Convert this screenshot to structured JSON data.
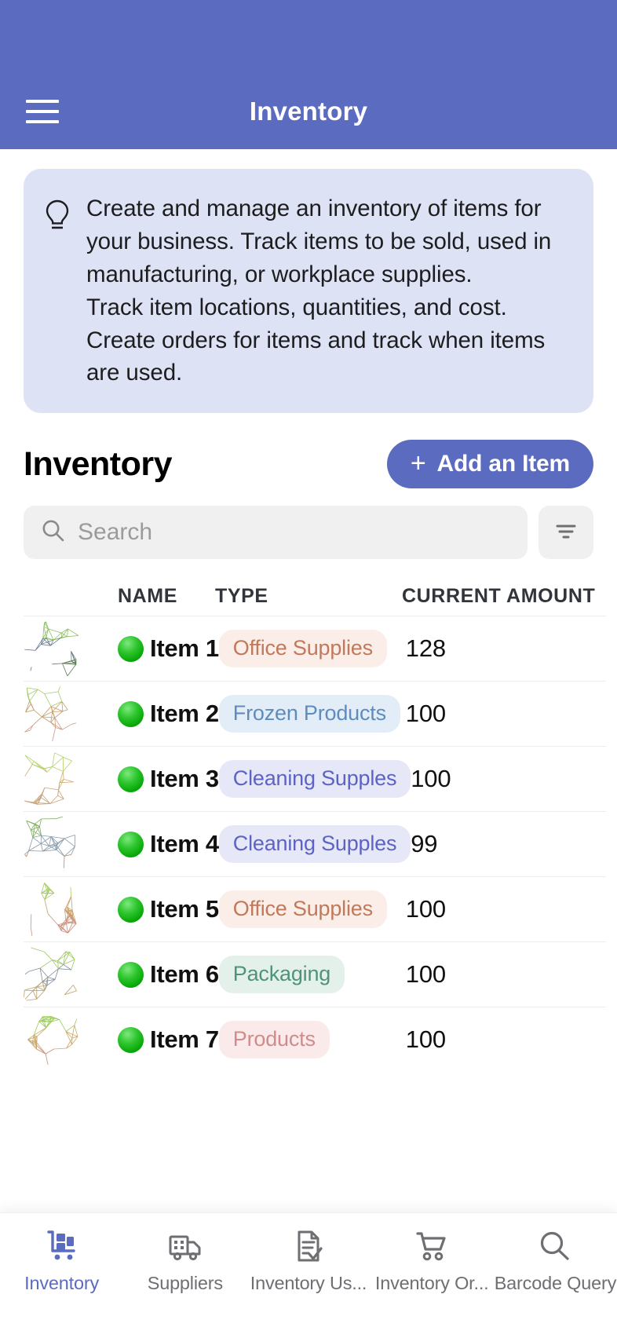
{
  "appbar": {
    "title": "Inventory",
    "menu_icon": "hamburger-menu-icon",
    "bg_color": "#5B6CC0"
  },
  "banner": {
    "icon": "lightbulb-icon",
    "lines": [
      "Create and manage an inventory of items for your business. Track items to be sold, used in manufacturing, or workplace supplies.",
      "Track item locations, quantities, and cost.",
      "Create orders for items and track when items are used."
    ],
    "bg_color": "#DEE2F5"
  },
  "section": {
    "title": "Inventory",
    "add_button_label": "Add an Item",
    "add_button_plus": "+",
    "add_button_color": "#5B6CC0"
  },
  "search": {
    "placeholder": "Search",
    "value": "",
    "icon": "search-icon",
    "filter_icon": "filter-sort-icon"
  },
  "table": {
    "columns": [
      "NAME",
      "TYPE",
      "CURRENT AMOUNT"
    ],
    "rows": [
      {
        "name": "Item 1",
        "type": "Office Supplies",
        "amount": "128",
        "status": "in-stock"
      },
      {
        "name": "Item 2",
        "type": "Frozen Products",
        "amount": "100",
        "status": "in-stock"
      },
      {
        "name": "Item 3",
        "type": "Cleaning Supples",
        "amount": "100",
        "status": "in-stock"
      },
      {
        "name": "Item 4",
        "type": "Cleaning Supples",
        "amount": "99",
        "status": "in-stock"
      },
      {
        "name": "Item 5",
        "type": "Office Supplies",
        "amount": "100",
        "status": "in-stock"
      },
      {
        "name": "Item 6",
        "type": "Packaging",
        "amount": "100",
        "status": "in-stock"
      },
      {
        "name": "Item 7",
        "type": "Products",
        "amount": "100",
        "status": "in-stock"
      }
    ],
    "chip_styles": {
      "Office Supplies": {
        "bg": "#FBEDE7",
        "fg": "#C07A5B"
      },
      "Frozen Products": {
        "bg": "#E3EDF8",
        "fg": "#5E8CBE"
      },
      "Cleaning Supples": {
        "bg": "#E6E7F7",
        "fg": "#5C63C4"
      },
      "Packaging": {
        "bg": "#E3F1EA",
        "fg": "#4F9478"
      },
      "Products": {
        "bg": "#FBEAEA",
        "fg": "#D08C8C"
      }
    },
    "status_color": "#16B516"
  },
  "bottom_nav": {
    "active_color": "#5B6CC0",
    "inactive_color": "#6E6E73",
    "items": [
      {
        "label": "Inventory",
        "icon": "inventory-cart-icon",
        "active": true
      },
      {
        "label": "Suppliers",
        "icon": "delivery-truck-icon",
        "active": false
      },
      {
        "label": "Inventory Us...",
        "icon": "document-check-icon",
        "active": false
      },
      {
        "label": "Inventory Or...",
        "icon": "shopping-cart-icon",
        "active": false
      },
      {
        "label": "Barcode Query",
        "icon": "magnifier-icon",
        "active": false
      }
    ]
  }
}
